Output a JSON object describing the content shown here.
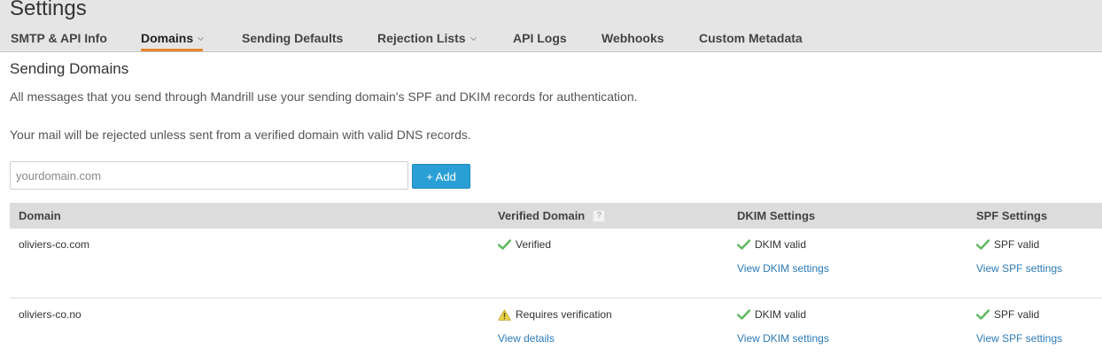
{
  "header": {
    "title": "Settings"
  },
  "tabs": [
    {
      "label": "SMTP & API Info",
      "dropdown": false,
      "active": false
    },
    {
      "label": "Domains",
      "dropdown": true,
      "active": true
    },
    {
      "label": "Sending Defaults",
      "dropdown": false,
      "active": false
    },
    {
      "label": "Rejection Lists",
      "dropdown": true,
      "active": false
    },
    {
      "label": "API Logs",
      "dropdown": false,
      "active": false
    },
    {
      "label": "Webhooks",
      "dropdown": false,
      "active": false
    },
    {
      "label": "Custom Metadata",
      "dropdown": false,
      "active": false
    }
  ],
  "section": {
    "title": "Sending Domains",
    "description_1": "All messages that you send through Mandrill use your sending domain's SPF and DKIM records for authentication.",
    "description_2": "Your mail will be rejected unless sent from a verified domain with valid DNS records."
  },
  "add_form": {
    "placeholder": "yourdomain.com",
    "value": "",
    "add_label": "+ Add"
  },
  "table": {
    "headers": {
      "domain": "Domain",
      "verified": "Verified Domain",
      "help": "?",
      "dkim": "DKIM Settings",
      "spf": "SPF Settings"
    },
    "rows": [
      {
        "domain": "oliviers-co.com",
        "verified_status": "Verified",
        "verified_icon": "check-icon",
        "verified_link": "",
        "dkim_status": "DKIM valid",
        "dkim_link": "View DKIM settings",
        "spf_status": "SPF valid",
        "spf_link": "View SPF settings"
      },
      {
        "domain": "oliviers-co.no",
        "verified_status": "Requires verification",
        "verified_icon": "warning-icon",
        "verified_link": "View details",
        "dkim_status": "DKIM valid",
        "dkim_link": "View DKIM settings",
        "spf_status": "SPF valid",
        "spf_link": "View SPF settings"
      }
    ]
  },
  "colors": {
    "accent_tab": "#e8852a",
    "button": "#2a9fd6",
    "link": "#2b7bb9",
    "check": "#5cb85c",
    "warning": "#e6c229"
  }
}
